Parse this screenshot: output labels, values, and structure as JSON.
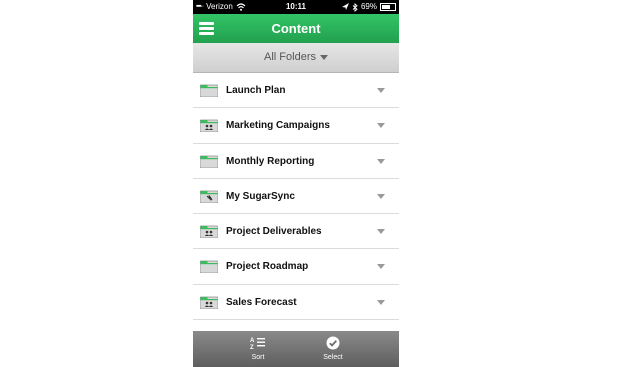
{
  "status_bar": {
    "carrier": "Verizon",
    "time": "10:11",
    "battery": "69%"
  },
  "nav": {
    "title": "Content"
  },
  "folder_filter": {
    "label": "All Folders"
  },
  "folders": [
    {
      "name": "Launch Plan",
      "icon": "folder-icon"
    },
    {
      "name": "Marketing Campaigns",
      "icon": "shared-folder-icon"
    },
    {
      "name": "Monthly Reporting",
      "icon": "folder-icon"
    },
    {
      "name": "My SugarSync",
      "icon": "sync-folder-icon"
    },
    {
      "name": "Project Deliverables",
      "icon": "shared-folder-icon"
    },
    {
      "name": "Project Roadmap",
      "icon": "folder-icon"
    },
    {
      "name": "Sales Forecast",
      "icon": "shared-folder-icon"
    }
  ],
  "toolbar": {
    "sort_label": "Sort",
    "select_label": "Select"
  },
  "colors": {
    "accent_green": "#2bb35a",
    "toolbar_gray": "#6e6e6e"
  }
}
